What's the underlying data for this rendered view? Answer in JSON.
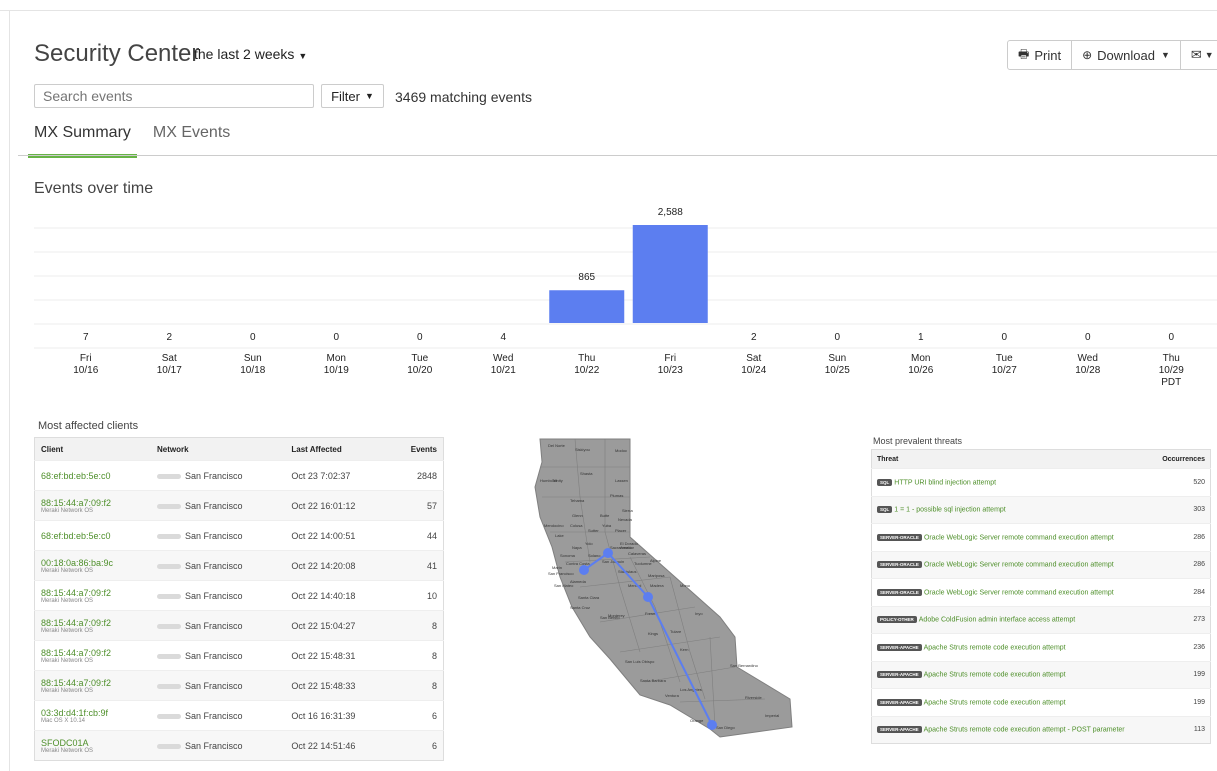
{
  "header": {
    "title": "Security Center",
    "range": "the last 2 weeks",
    "print": "Print",
    "download": "Download"
  },
  "search": {
    "placeholder": "Search events"
  },
  "filter": {
    "label": "Filter",
    "matching": "3469 matching events"
  },
  "tabs": [
    {
      "label": "MX Summary"
    },
    {
      "label": "MX Events"
    }
  ],
  "events_title": "Events over time",
  "chart_data": {
    "type": "bar",
    "categories": [
      [
        "Fri",
        "10/16"
      ],
      [
        "Sat",
        "10/17"
      ],
      [
        "Sun",
        "10/18"
      ],
      [
        "Mon",
        "10/19"
      ],
      [
        "Tue",
        "10/20"
      ],
      [
        "Wed",
        "10/21"
      ],
      [
        "Thu",
        "10/22"
      ],
      [
        "Fri",
        "10/23"
      ],
      [
        "Sat",
        "10/24"
      ],
      [
        "Sun",
        "10/25"
      ],
      [
        "Mon",
        "10/26"
      ],
      [
        "Tue",
        "10/27"
      ],
      [
        "Wed",
        "10/28"
      ],
      [
        "Thu",
        "10/29",
        "PDT"
      ]
    ],
    "values": [
      7,
      2,
      0,
      0,
      0,
      4,
      865,
      2588,
      2,
      0,
      1,
      0,
      0,
      0
    ],
    "data_labels": [
      "7",
      "2",
      "0",
      "0",
      "0",
      "4",
      "865",
      "2,588",
      "2",
      "0",
      "1",
      "0",
      "0",
      "0"
    ],
    "bar_color": "#5c7ef0",
    "ylim": [
      0,
      2588
    ],
    "grid": true
  },
  "clients_title": "Most affected clients",
  "clients": {
    "headers": [
      "Client",
      "Network",
      "Last Affected",
      "Events"
    ],
    "rows": [
      {
        "client": "68:ef:bd:eb:5e:c0",
        "os": "",
        "network": "San Francisco",
        "last": "Oct 23 7:02:37",
        "events": "2848"
      },
      {
        "client": "88:15:44:a7:09:f2",
        "os": "Meraki Network OS",
        "network": "San Francisco",
        "last": "Oct 22 16:01:12",
        "events": "57"
      },
      {
        "client": "68:ef:bd:eb:5e:c0",
        "os": "",
        "network": "San Francisco",
        "last": "Oct 22 14:00:51",
        "events": "44"
      },
      {
        "client": "00:18:0a:86:ba:9c",
        "os": "Meraki Network OS",
        "network": "San Francisco",
        "last": "Oct 22 14:20:08",
        "events": "41"
      },
      {
        "client": "88:15:44:a7:09:f2",
        "os": "Meraki Network OS",
        "network": "San Francisco",
        "last": "Oct 22 14:40:18",
        "events": "10"
      },
      {
        "client": "88:15:44:a7:09:f2",
        "os": "Meraki Network OS",
        "network": "San Francisco",
        "last": "Oct 22 15:04:27",
        "events": "8"
      },
      {
        "client": "88:15:44:a7:09:f2",
        "os": "Meraki Network OS",
        "network": "San Francisco",
        "last": "Oct 22 15:48:31",
        "events": "8"
      },
      {
        "client": "88:15:44:a7:09:f2",
        "os": "Meraki Network OS",
        "network": "San Francisco",
        "last": "Oct 22 15:48:33",
        "events": "8"
      },
      {
        "client": "03:3d:d4:1f:cb:9f",
        "os": "Mac OS X 10.14",
        "network": "San Francisco",
        "last": "Oct 16 16:31:39",
        "events": "6"
      },
      {
        "client": "SFODC01A",
        "os": "Meraki Network OS",
        "network": "San Francisco",
        "last": "Oct 22 14:51:46",
        "events": "6"
      }
    ]
  },
  "threats_title": "Most prevalent threats",
  "threats": {
    "headers": [
      "Threat",
      "Occurrences"
    ],
    "rows": [
      {
        "tag": "SQL",
        "name": "HTTP URI blind injection attempt",
        "count": "520"
      },
      {
        "tag": "SQL",
        "name": "1 = 1 - possible sql injection attempt",
        "count": "303"
      },
      {
        "tag": "SERVER-ORACLE",
        "name": "Oracle WebLogic Server remote command execution attempt",
        "count": "286"
      },
      {
        "tag": "SERVER-ORACLE",
        "name": "Oracle WebLogic Server remote command execution attempt",
        "count": "286"
      },
      {
        "tag": "SERVER-ORACLE",
        "name": "Oracle WebLogic Server remote command execution attempt",
        "count": "284"
      },
      {
        "tag": "POLICY-OTHER",
        "name": "Adobe ColdFusion admin interface access attempt",
        "count": "273"
      },
      {
        "tag": "SERVER-APACHE",
        "name": "Apache Struts remote code execution attempt",
        "count": "236"
      },
      {
        "tag": "SERVER-APACHE",
        "name": "Apache Struts remote code execution attempt",
        "count": "199"
      },
      {
        "tag": "SERVER-APACHE",
        "name": "Apache Struts remote code execution attempt",
        "count": "199"
      },
      {
        "tag": "SERVER-APACHE",
        "name": "Apache Struts remote code execution attempt - POST parameter",
        "count": "113"
      }
    ]
  },
  "map": {
    "labels": [
      "San Francisco",
      "San Diego",
      "Los Angeles",
      "Fresno",
      "Sacramento",
      "San Bernardino",
      "Inyo",
      "Kern",
      "Tulare",
      "Monterey",
      "Riverside",
      "Imperial",
      "Modoc",
      "Shasta",
      "Humboldt",
      "Lassen",
      "Mono",
      "Siskiyou",
      "Tehama",
      "Glenn",
      "Butte",
      "Mendocino",
      "Sonoma",
      "Napa",
      "Yolo",
      "Placer",
      "El Dorado",
      "Kings",
      "San Luis Obispo",
      "Santa Barbara",
      "Ventura",
      "Orange",
      "Merced",
      "Madera",
      "Colusa",
      "Lake",
      "Sutter",
      "Yuba",
      "Nevada",
      "Sierra",
      "Plumas",
      "Alpine",
      "Del Norte",
      "Trinity",
      "Marin",
      "Solano",
      "San Mateo",
      "Alameda",
      "Santa Clara",
      "Santa Cruz",
      "San Benito",
      "Stanislaus",
      "Mariposa",
      "Tuolumne",
      "Calaveras",
      "Amador",
      "San Joaquin",
      "Contra Costa"
    ],
    "marker_color": "#5c7ef0"
  }
}
